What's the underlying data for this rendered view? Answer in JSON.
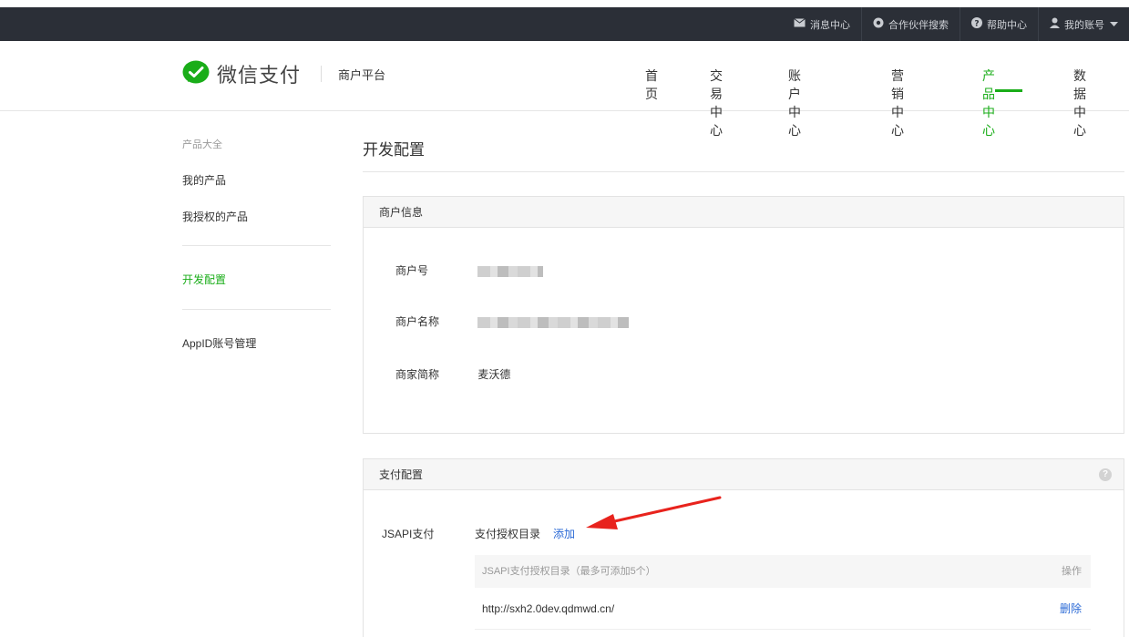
{
  "topbar": {
    "items": [
      {
        "icon": "mail-icon",
        "label": "消息中心"
      },
      {
        "icon": "partner-search-icon",
        "label": "合作伙伴搜索"
      },
      {
        "icon": "help-circle-icon",
        "label": "帮助中心"
      },
      {
        "icon": "user-icon",
        "label": "我的账号"
      }
    ]
  },
  "header": {
    "brand": "微信支付",
    "platform": "商户平台",
    "nav": [
      {
        "label": "首页"
      },
      {
        "label": "交易中心"
      },
      {
        "label": "账户中心"
      },
      {
        "label": "营销中心"
      },
      {
        "label": "产品中心",
        "active": true
      },
      {
        "label": "数据中心"
      }
    ]
  },
  "sidebar": {
    "group": "产品大全",
    "items": [
      "我的产品",
      "我授权的产品",
      "开发配置",
      "AppID账号管理"
    ],
    "active": "开发配置"
  },
  "main": {
    "title": "开发配置",
    "merchant_panel": {
      "title": "商户信息",
      "rows": [
        {
          "label": "商户号",
          "value": ""
        },
        {
          "label": "商户名称",
          "value": ""
        },
        {
          "label": "商家简称",
          "value": "麦沃德"
        }
      ]
    },
    "pay_panel": {
      "title": "支付配置",
      "jsapi_label": "JSAPI支付",
      "dir_label": "支付授权目录",
      "add_label": "添加",
      "table": {
        "header": "JSAPI支付授权目录（最多可添加5个）",
        "op_header": "操作",
        "rows": [
          {
            "url": "http://sxh2.0dev.qdmwd.cn/",
            "action": "删除"
          }
        ]
      }
    }
  },
  "colors": {
    "accent": "#1aad19",
    "link": "#2b6ad6",
    "topbar": "#2b2f37",
    "arrow": "#e8231d"
  }
}
